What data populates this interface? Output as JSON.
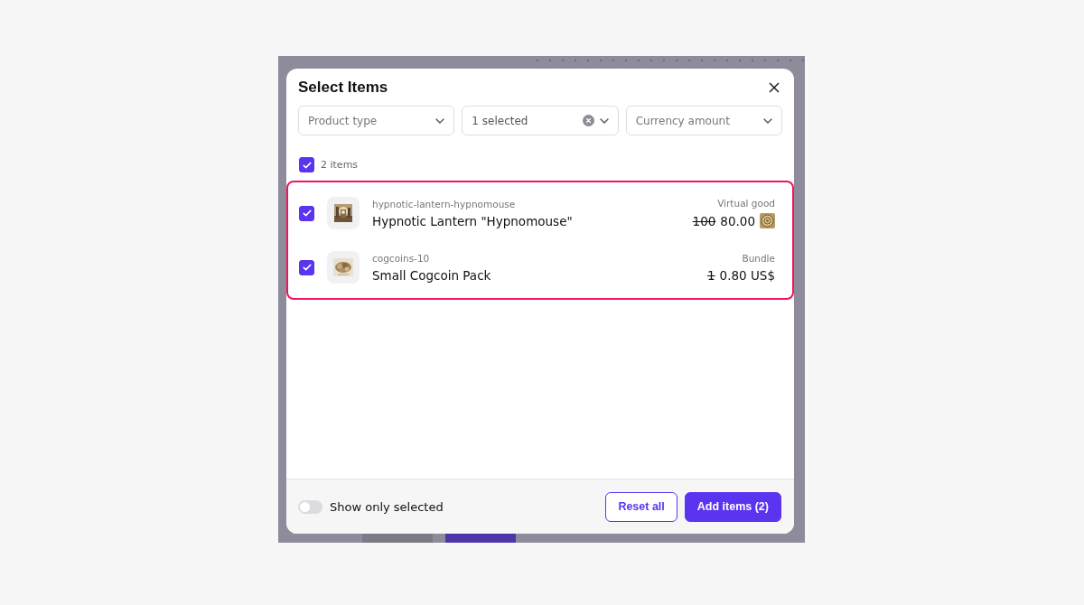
{
  "dialog": {
    "title": "Select Items",
    "filters": [
      {
        "placeholder": "Product type",
        "clearable": false
      },
      {
        "value": "1 selected",
        "clearable": true
      },
      {
        "placeholder": "Currency amount",
        "clearable": false
      }
    ],
    "select_all": {
      "label": "2 items",
      "checked": true
    },
    "items": [
      {
        "sku": "hypnotic-lantern-hypnomouse",
        "name": "Hypnotic Lantern \"Hypnomouse\"",
        "type": "Virtual good",
        "old_price": "100",
        "price": "80.00",
        "currency_icon": true,
        "checked": true
      },
      {
        "sku": "cogcoins-10",
        "name": "Small Cogcoin Pack",
        "type": "Bundle",
        "old_price": "1",
        "price": "0.80 US$",
        "currency_icon": false,
        "checked": true
      }
    ],
    "toggle": {
      "label": "Show only selected",
      "on": false
    },
    "buttons": [
      {
        "label": "Reset all",
        "kind": "secondary"
      },
      {
        "label": "Add items (2)",
        "kind": "primary"
      }
    ]
  }
}
